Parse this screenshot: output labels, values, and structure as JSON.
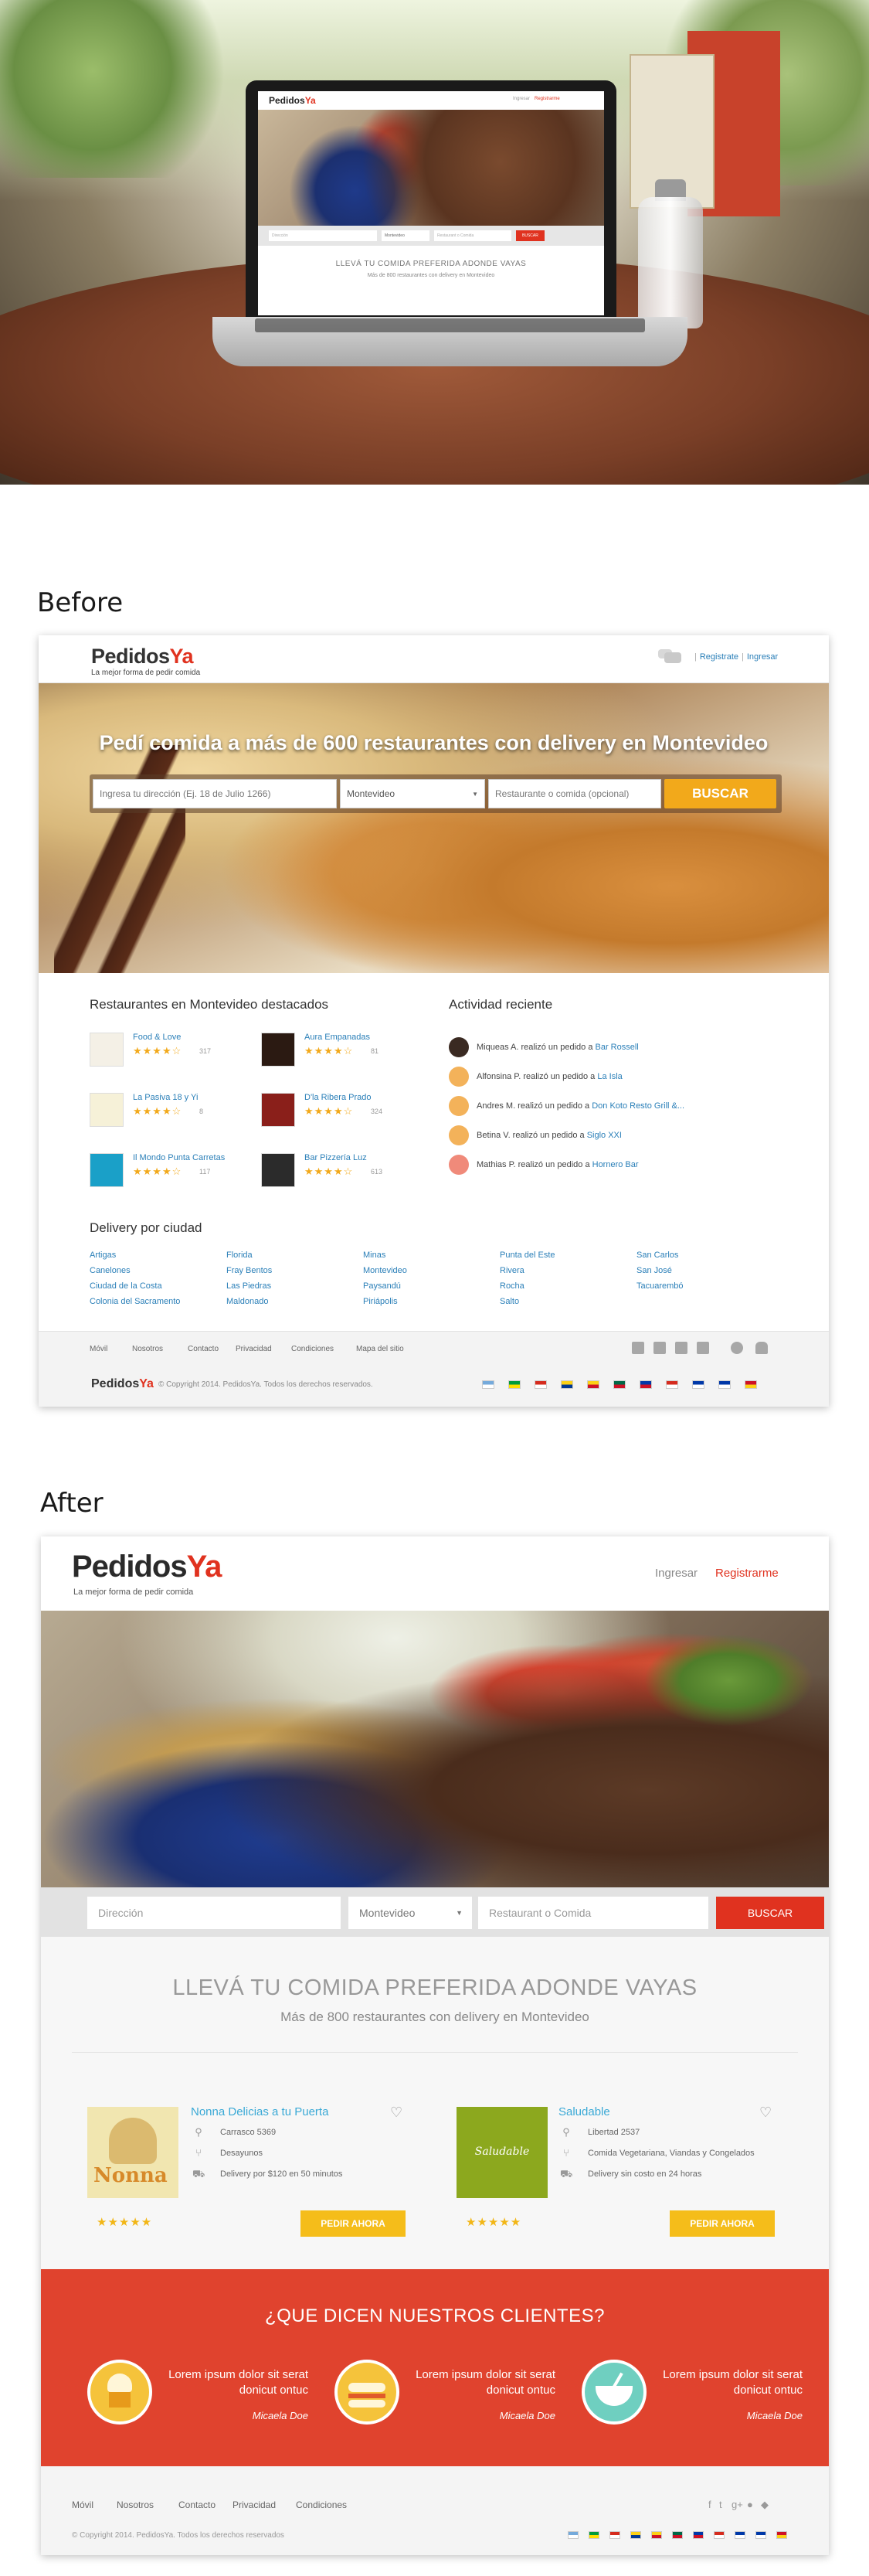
{
  "labels": {
    "before": "Before",
    "after": "After"
  },
  "mockup": {
    "logo_main": "Pedidos",
    "logo_accent": "Ya",
    "links": {
      "ingresar": "Ingresar",
      "registrarme": "Registrarme"
    },
    "search": {
      "direccion": "Dirección",
      "ciudad": "Montevideo",
      "restaurant": "Restaurant o Comida",
      "button": "BUSCAR"
    },
    "title": "LLEVÁ TU COMIDA PREFERIDA ADONDE VAYAS",
    "subtitle": "Más de 800 restaurantes con delivery en Montevideo"
  },
  "before": {
    "logo_main": "Pedidos",
    "logo_accent": "Ya",
    "tagline": "La mejor forma de pedir comida",
    "auth": {
      "register": "Registrate",
      "login": "Ingresar"
    },
    "hero_title": "Pedí comida a más de 600 restaurantes con delivery en Montevideo",
    "search": {
      "address_placeholder": "Ingresa tu dirección (Ej. 18 de Julio 1266)",
      "city": "Montevideo",
      "food_placeholder": "Restaurante o comida (opcional)",
      "button": "BUSCAR"
    },
    "featured_title": "Restaurantes en Montevideo destacados",
    "restaurants": [
      {
        "name": "Food & Love",
        "stars": "★★★★☆",
        "count": "317",
        "color": "#f4f0e6"
      },
      {
        "name": "Aura Empanadas",
        "stars": "★★★★☆",
        "count": "81",
        "color": "#2b1a12"
      },
      {
        "name": "La Pasiva 18 y Yi",
        "stars": "★★★★☆",
        "count": "8",
        "color": "#f6f1d8"
      },
      {
        "name": "D'la Ribera Prado",
        "stars": "★★★★☆",
        "count": "324",
        "color": "#8a1f1a"
      },
      {
        "name": "Il Mondo Punta Carretas",
        "stars": "★★★★☆",
        "count": "117",
        "color": "#1aa0c8"
      },
      {
        "name": "Bar Pizzería Luz",
        "stars": "★★★★☆",
        "count": "613",
        "color": "#2b2b2b"
      }
    ],
    "activity_title": "Actividad reciente",
    "activity": [
      {
        "text": "Miqueas A. realizó un pedido a ",
        "place": "Bar Rossell",
        "color": "#3a2a22"
      },
      {
        "text": "Alfonsina P. realizó un pedido a ",
        "place": "La Isla",
        "color": "#f3b25a"
      },
      {
        "text": "Andres M. realizó un pedido a ",
        "place": "Don Koto Resto Grill &...",
        "color": "#f3b25a"
      },
      {
        "text": "Betina V. realizó un pedido a ",
        "place": "Siglo XXI",
        "color": "#f3b25a"
      },
      {
        "text": "Mathias P. realizó un pedido a ",
        "place": "Hornero Bar",
        "color": "#f08a7a"
      }
    ],
    "delivery_title": "Delivery por ciudad",
    "cities": [
      [
        "Artigas",
        "Canelones",
        "Ciudad de la Costa",
        "Colonia del Sacramento"
      ],
      [
        "Florida",
        "Fray Bentos",
        "Las Piedras",
        "Maldonado"
      ],
      [
        "Minas",
        "Montevideo",
        "Paysandú",
        "Piriápolis"
      ],
      [
        "Punta del Este",
        "Rivera",
        "Rocha",
        "Salto"
      ],
      [
        "San Carlos",
        "San José",
        "Tacuarembó"
      ]
    ],
    "footer_links": [
      "Móvil",
      "Nosotros",
      "Contacto",
      "Privacidad",
      "Condiciones",
      "Mapa del sitio"
    ],
    "copyright": "© Copyright 2014. PedidosYa. Todos los derechos reservados."
  },
  "after": {
    "logo_main": "Pedidos",
    "logo_accent": "Ya",
    "tagline": "La mejor forma de pedir comida",
    "ingresar": "Ingresar",
    "registrarme": "Registrarme",
    "search": {
      "direccion": "Dirección",
      "ciudad": "Montevideo",
      "restaurant": "Restaurant o Comida",
      "button": "BUSCAR"
    },
    "title": "LLEVÁ TU COMIDA PREFERIDA ADONDE VAYAS",
    "subtitle": "Más de 800 restaurantes con delivery en Montevideo",
    "cards": [
      {
        "title": "Nonna Delicias a tu Puerta",
        "logo_text": "Nonna",
        "address": "Carrasco 5369",
        "category": "Desayunos",
        "delivery": "Delivery por $120 en 50 minutos",
        "stars": "★★★★★",
        "button": "PEDIR AHORA"
      },
      {
        "title": "Saludable",
        "logo_text": "Saludable",
        "address": "Libertad 2537",
        "category": "Comida Vegetariana, Viandas y Congelados",
        "delivery": "Delivery sin costo en 24 horas",
        "stars": "★★★★★",
        "button": "PEDIR AHORA"
      }
    ],
    "testimonials_title": "¿QUE DICEN NUESTROS CLIENTES?",
    "testimonials": [
      {
        "text": "Lorem ipsum dolor sit serat donicut ontuc",
        "author": "Micaela Doe",
        "circle": "#f5c33b"
      },
      {
        "text": "Lorem ipsum dolor sit serat donicut ontuc",
        "author": "Micaela Doe",
        "circle": "#f5c33b"
      },
      {
        "text": "Lorem ipsum dolor sit serat donicut ontuc",
        "author": "Micaela Doe",
        "circle": "#6fcfc0"
      }
    ],
    "footer_links": [
      "Móvil",
      "Nosotros",
      "Contacto",
      "Privacidad",
      "Condiciones"
    ],
    "copyright": "© Copyright 2014. PedidosYa. Todos los derechos reservados"
  },
  "colors": {
    "brand_red": "#e0321f",
    "brand_yellow": "#f2a91b",
    "link_blue": "#2a7fb8"
  }
}
